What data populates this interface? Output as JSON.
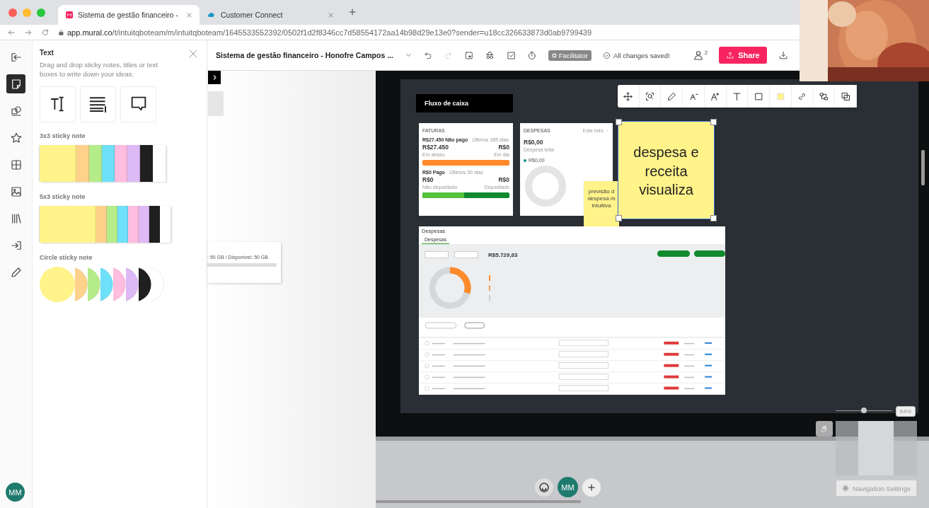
{
  "browser": {
    "tabs": [
      {
        "title": "Sistema de gestão financeiro -",
        "selected": true
      },
      {
        "title": "Customer Connect",
        "selected": false
      }
    ],
    "url_host": "app.mural.co",
    "url_path": "/t/intuitqboteam/m/intuitqboteam/1645533552392/0502f1d2f8346cc7d58554172aa14b98d29e13e0?sender=u18cc326633873d0ab9799439"
  },
  "topbar": {
    "title": "Sistema de gestão financeiro - Honofre Campos ...",
    "facilitator": "Facilitator",
    "save_status": "All changes saved!",
    "member_count": "2",
    "share": "Share"
  },
  "rail": [
    {
      "selected": false
    },
    {
      "selected": true
    },
    {
      "selected": false
    },
    {
      "selected": false
    },
    {
      "selected": false
    },
    {
      "selected": false
    },
    {
      "selected": false
    },
    {
      "selected": false
    },
    {
      "selected": false
    }
  ],
  "user": {
    "initials": "MM"
  },
  "panel": {
    "title": "Text",
    "description": "Drag and drop sticky notes, titles or text boxes to write down your ideas.",
    "sections": [
      {
        "label": "3x3 sticky note",
        "kind": "square",
        "colors": [
          {
            "color": "#fff38a"
          },
          {
            "color": "#ffd28c"
          },
          {
            "color": "#b5ec8a"
          },
          {
            "color": "#6ee0f7"
          },
          {
            "color": "#ffbde0"
          },
          {
            "color": "#ddb9f5"
          },
          {
            "color": "#1f1f1f"
          },
          {
            "color": "#ffffff"
          }
        ]
      },
      {
        "label": "5x3 sticky note",
        "kind": "wide",
        "colors": [
          {
            "color": "#fff38a"
          },
          {
            "color": "#ffd28c"
          },
          {
            "color": "#b5ec8a"
          },
          {
            "color": "#6ee0f7"
          },
          {
            "color": "#ffbde0"
          },
          {
            "color": "#ddb9f5"
          },
          {
            "color": "#1f1f1f"
          },
          {
            "color": "#ffffff"
          }
        ]
      },
      {
        "label": "Circle sticky note",
        "kind": "circle",
        "colors": [
          {
            "color": "#fff38a"
          },
          {
            "color": "#ffd28c"
          },
          {
            "color": "#b5ec8a"
          },
          {
            "color": "#6ee0f7"
          },
          {
            "color": "#ffbde0"
          },
          {
            "color": "#ddb9f5"
          },
          {
            "color": "#1f1f1f"
          },
          {
            "color": "#ffffff"
          }
        ]
      }
    ]
  },
  "canvas": {
    "storage_text": ": 50 GB / Disponível: 50 GB",
    "header": "Fluxo de caixa",
    "faturas": {
      "title": "FATURAS",
      "unpaid": "R$27.450 Não pago",
      "unpaid_period": "Últimos 365 dias",
      "overdue_amount": "R$27.450",
      "current_amount": "R$0",
      "overdue_label": "Em atraso",
      "current_label": "Em dia",
      "overdue_bar": {
        "level": 1
      },
      "paid": "R$0 Pago",
      "paid_period": "Últimos 30 dias",
      "not_deposited_amount": "R$0",
      "deposited_amount": "R$0",
      "not_deposited_label": "Não depositado",
      "deposited_label": "Depositado",
      "deposit_bar": {
        "level": 0.48
      }
    },
    "despesas_card": {
      "title": "DESPESAS",
      "period": "Este mês",
      "total": "R$0,00",
      "total_label": "Despesa total",
      "legend": "R$0,00"
    },
    "stickies": [
      {
        "text": "previsão d despesa m intuitiva",
        "selected": false
      },
      {
        "text": "despesa e receita visualiza",
        "selected": true
      }
    ],
    "expenses": {
      "title": "Despesas",
      "tabs": [
        {
          "label": "Despesas",
          "selected": true
        }
      ],
      "total": "R$5.729,83"
    },
    "member_initials": "MM",
    "zoom_slider": {
      "level": 0.5
    },
    "zoom": "64%",
    "navigation_settings": "Navigation Settings"
  }
}
